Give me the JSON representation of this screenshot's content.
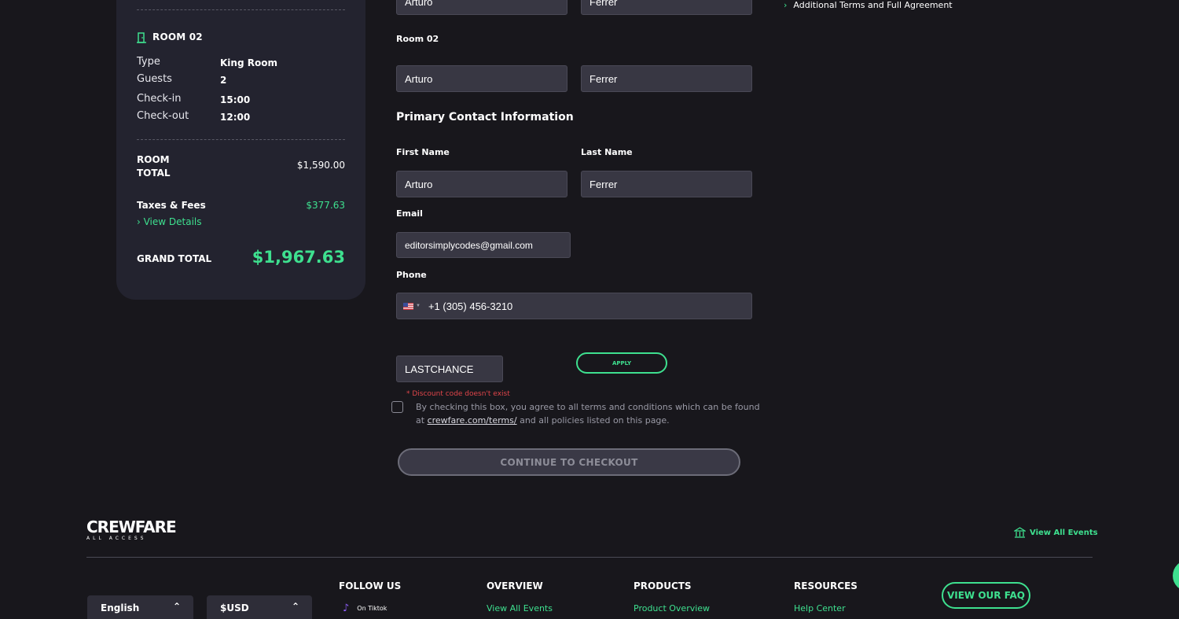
{
  "summary": {
    "room_title": "ROOM 02",
    "rows": [
      {
        "label": "Type",
        "value": "King Room"
      },
      {
        "label": "Guests",
        "value": "2"
      },
      {
        "label": "Check-in",
        "value": "15:00"
      },
      {
        "label": "Check-out",
        "value": "12:00"
      }
    ],
    "room_total_label_1": "ROOM",
    "room_total_label_2": "TOTAL",
    "room_total_value": "$1,590.00",
    "taxes_label": "Taxes & Fees",
    "taxes_value": "$377.63",
    "view_details": "› View Details",
    "grand_total_label": "GRAND TOTAL",
    "grand_total_value": "$1,967.63"
  },
  "form": {
    "room1_first": "Arturo",
    "room1_last": "Ferrer",
    "room02_label": "Room 02",
    "room2_first": "Arturo",
    "room2_last": "Ferrer",
    "primary_heading": "Primary Contact Information",
    "first_name_label": "First Name",
    "last_name_label": "Last Name",
    "first_name": "Arturo",
    "last_name": "Ferrer",
    "email_label": "Email",
    "email": "editorsimplycodes@gmail.com",
    "phone_label": "Phone",
    "phone": "+1 (305) 456-3210",
    "discount_code": "LASTCHANCE",
    "apply_label": "APPLY",
    "discount_error": "* Discount code doesn't exist",
    "terms_text_1": "By checking this box, you agree to all terms and conditions which can be found",
    "terms_text_2_pre": "at",
    "terms_link": "crewfare.com/terms/",
    "terms_text_2_post": "and all policies listed on this page.",
    "continue_label": "CONTINUE TO CHECKOUT"
  },
  "side": {
    "additional_terms": "Additional Terms and Full Agreement"
  },
  "footer": {
    "logo_main": "CREWFARE",
    "logo_sub": "ALL ACCESS",
    "view_all_events": "View All Events",
    "language": "English",
    "currency": "$USD",
    "follow_us": "FOLLOW US",
    "tiktok": "On Tiktok",
    "overview": "OVERVIEW",
    "overview_link": "View All Events",
    "products": "PRODUCTS",
    "products_link": "Product Overview",
    "resources": "RESOURCES",
    "resources_link": "Help Center",
    "faq_button": "VIEW OUR FAQ"
  },
  "colors": {
    "background": "#18171c",
    "card": "#23232f",
    "accent": "#3ee08f",
    "input": "#383743",
    "error": "#e0454a"
  }
}
